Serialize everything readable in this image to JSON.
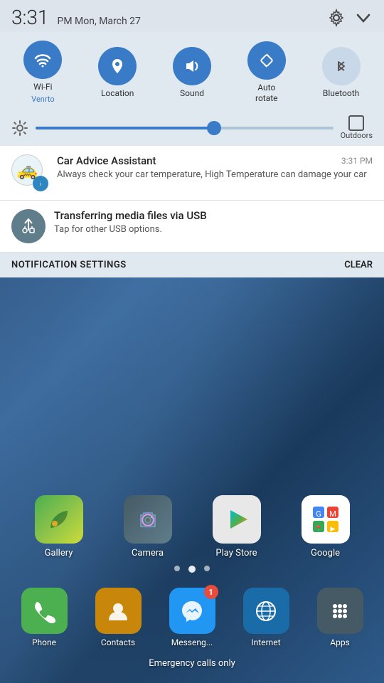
{
  "status": {
    "time": "3:31",
    "period": "PM",
    "date": "Mon, March 27"
  },
  "toggles": [
    {
      "id": "wifi",
      "label": "Wi-Fi",
      "sublabel": "Venrto",
      "active": true
    },
    {
      "id": "location",
      "label": "Location",
      "sublabel": "",
      "active": true
    },
    {
      "id": "sound",
      "label": "Sound",
      "sublabel": "",
      "active": true
    },
    {
      "id": "autorotate",
      "label": "Auto\nrotate",
      "sublabel": "",
      "active": true
    },
    {
      "id": "bluetooth",
      "label": "Bluetooth",
      "sublabel": "",
      "active": false
    }
  ],
  "brightness": {
    "outdoors_label": "Outdoors"
  },
  "notifications": [
    {
      "app": "Car Advice Assistant",
      "time": "3:31 PM",
      "text": "Always check your car temperature, High Temperature can damage your car"
    },
    {
      "app": "Transferring media files via USB",
      "time": "",
      "text": "Tap for other USB options."
    }
  ],
  "notification_bar": {
    "settings_label": "NOTIFICATION SETTINGS",
    "clear_label": "CLEAR"
  },
  "app_grid": [
    {
      "label": "Gallery",
      "icon": "gallery"
    },
    {
      "label": "Camera",
      "icon": "camera"
    },
    {
      "label": "Play Store",
      "icon": "playstore"
    },
    {
      "label": "Google",
      "icon": "google"
    }
  ],
  "dock": [
    {
      "label": "Phone",
      "icon": "phone",
      "badge": null
    },
    {
      "label": "Contacts",
      "icon": "contacts",
      "badge": null
    },
    {
      "label": "Messeng...",
      "icon": "messenger",
      "badge": "1"
    },
    {
      "label": "Internet",
      "icon": "internet",
      "badge": null
    },
    {
      "label": "Apps",
      "icon": "apps",
      "badge": null
    }
  ],
  "emergency": {
    "text": "Emergency calls only"
  }
}
